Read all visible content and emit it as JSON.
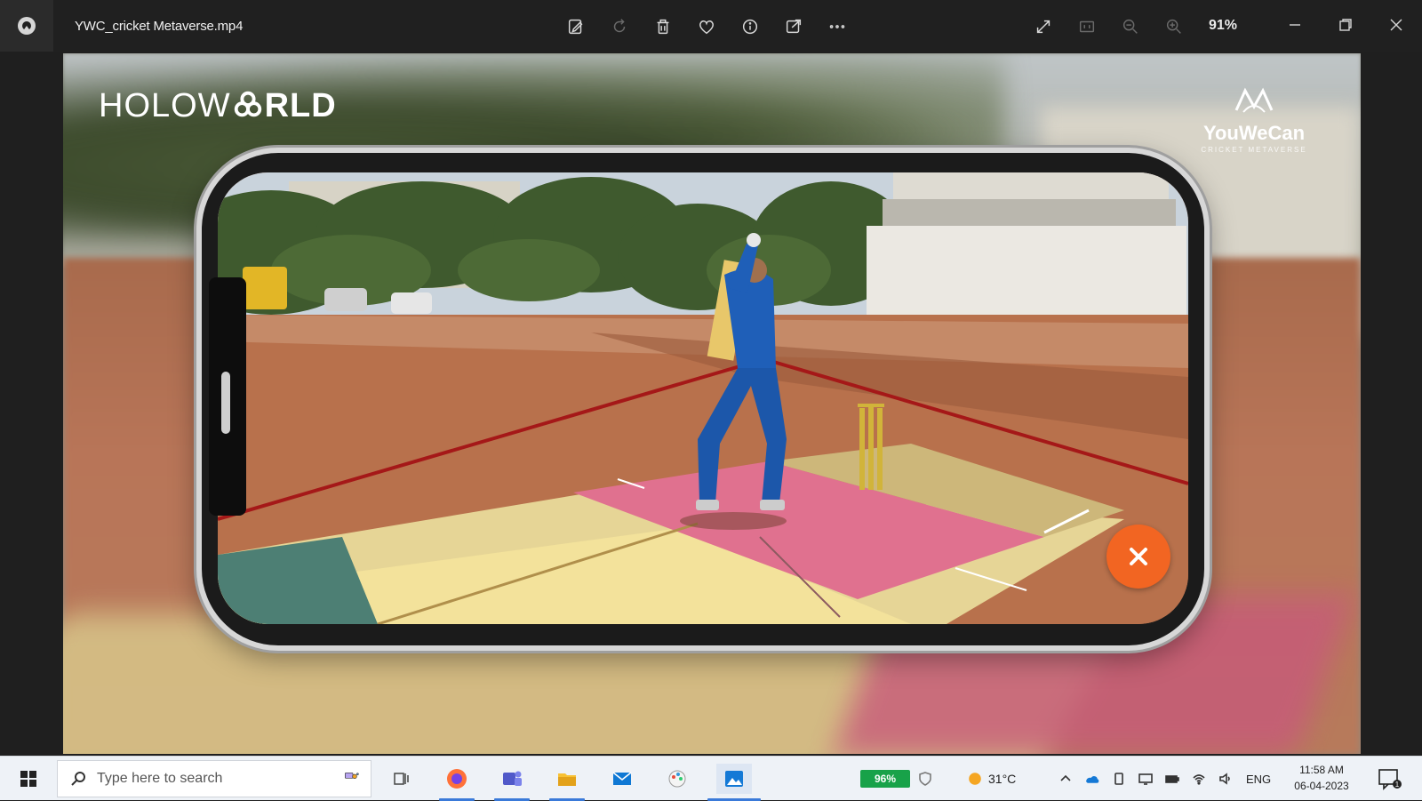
{
  "titlebar": {
    "file_name": "YWC_cricket Metaverse.mp4",
    "zoom_label": "91%",
    "tools": [
      "edit-icon",
      "rotate-icon",
      "delete-icon",
      "favorite-icon",
      "info-icon",
      "share-icon",
      "more-icon"
    ],
    "view_tools": [
      "fullscreen-icon",
      "fit-icon",
      "zoom-out-icon",
      "zoom-in-icon"
    ],
    "window_controls": [
      "minimize-icon",
      "restore-icon",
      "close-icon"
    ]
  },
  "media": {
    "left_logo_a": "HOLOW",
    "left_logo_b": "RLD",
    "right_logo_title": "YouWeCan",
    "right_logo_sub": "CRICKET METAVERSE",
    "colors": {
      "accent": "#f26522",
      "pitch_pink": "#e0718f",
      "pitch_yellow": "#f3e29b",
      "boundary": "#a51818",
      "jersey": "#1f5fb8"
    }
  },
  "taskbar": {
    "search_placeholder": "Type here to search",
    "pinned_apps": [
      "firefox-icon",
      "teams-icon",
      "file-explorer-icon",
      "mail-icon",
      "paint-icon",
      "photos-icon"
    ],
    "battery": "96%",
    "weather": "31°C",
    "language": "ENG",
    "time": "11:58 AM",
    "date": "06-04-2023"
  }
}
